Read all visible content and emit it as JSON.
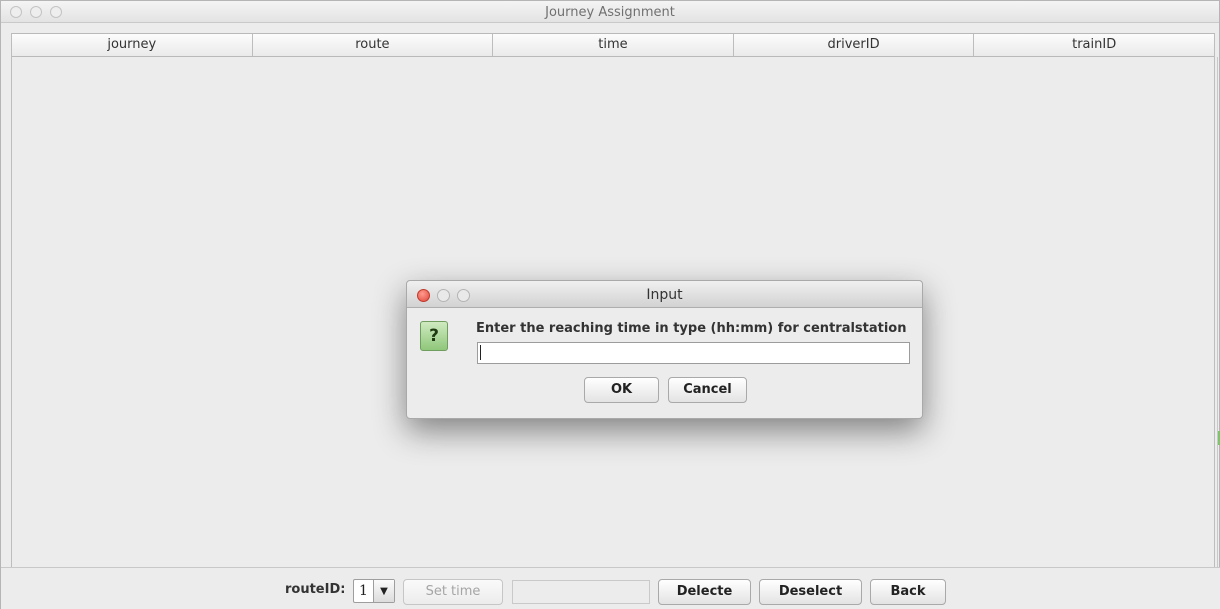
{
  "window": {
    "title": "Journey Assignment"
  },
  "table": {
    "columns": [
      "journey",
      "route",
      "time",
      "driverID",
      "trainID"
    ]
  },
  "toolbar": {
    "route_label": "routeID:",
    "route_value": "1",
    "set_time_label": "Set time",
    "time_value": "",
    "delete_label": "Delecte",
    "deselect_label": "Deselect",
    "back_label": "Back"
  },
  "dialog": {
    "title": "Input",
    "icon_glyph": "?",
    "prompt": "Enter the reaching time in type (hh:mm) for centralstation",
    "input_value": "",
    "ok_label": "OK",
    "cancel_label": "Cancel"
  },
  "icons": {
    "dialog_icon": "question-icon",
    "combo_arrow": "chevron-down-icon"
  },
  "colors": {
    "close_button": "#e0463b",
    "question_icon": "#8fc77a"
  }
}
